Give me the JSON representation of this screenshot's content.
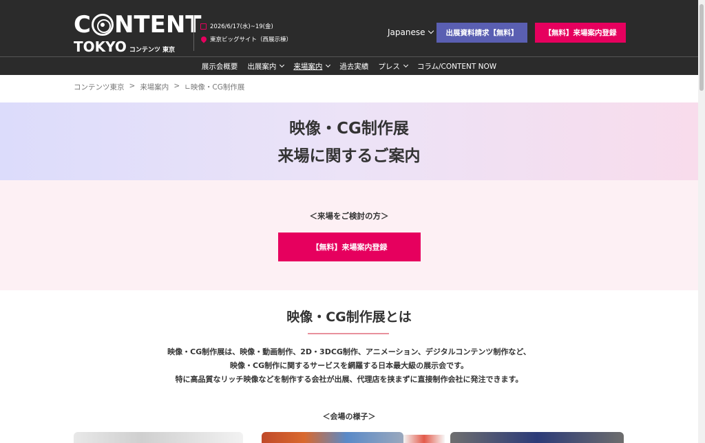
{
  "header": {
    "logo_content_pre": "C",
    "logo_content_post": "NTENT",
    "logo_tokyo": "TOKYO",
    "logo_jp": "コンテンツ 東京",
    "date": "2026/6/17(水)~19(金)",
    "venue": "東京ビッグサイト（西展示棟）",
    "language": "Japanese",
    "exhibit_button": "出展資料請求【無料】",
    "visit_button": "【無料】来場案内登録"
  },
  "nav": {
    "items": [
      {
        "label": "展示会概要",
        "dropdown": false,
        "active": false
      },
      {
        "label": "出展案内",
        "dropdown": true,
        "active": false
      },
      {
        "label": "来場案内",
        "dropdown": true,
        "active": true
      },
      {
        "label": "過去実績",
        "dropdown": false,
        "active": false
      },
      {
        "label": "プレス",
        "dropdown": true,
        "active": false
      },
      {
        "label": "コラム/CONTENT NOW",
        "dropdown": false,
        "active": false
      }
    ]
  },
  "breadcrumb": {
    "items": [
      "コンテンツ東京",
      "来場案内",
      "∟映像・CG制作展"
    ],
    "separator": ">"
  },
  "hero": {
    "line1": "映像・CG制作展",
    "line2": "来場に関するご案内"
  },
  "cta": {
    "caption": "＜来場をご検討の方＞",
    "button": "【無料】来場案内登録"
  },
  "about": {
    "title": "映像・CG制作展とは",
    "line1": "映像・CG制作展は、映像・動画制作、2D・3DCG制作、アニメーション、デジタルコンテンツ制作など、",
    "line2": "映像・CG制作に関するサービスを網羅する日本最大級の展示会です。",
    "line3": "特に高品質なリッチ映像などを制作する会社が出展、代理店を挟まずに直接制作会社に発注できます。"
  },
  "venue": {
    "caption": "＜会場の様子＞"
  },
  "colors": {
    "header_bg": "#2b2b2b",
    "accent_pink": "#e6005e",
    "accent_purple": "#5a5fb2"
  }
}
